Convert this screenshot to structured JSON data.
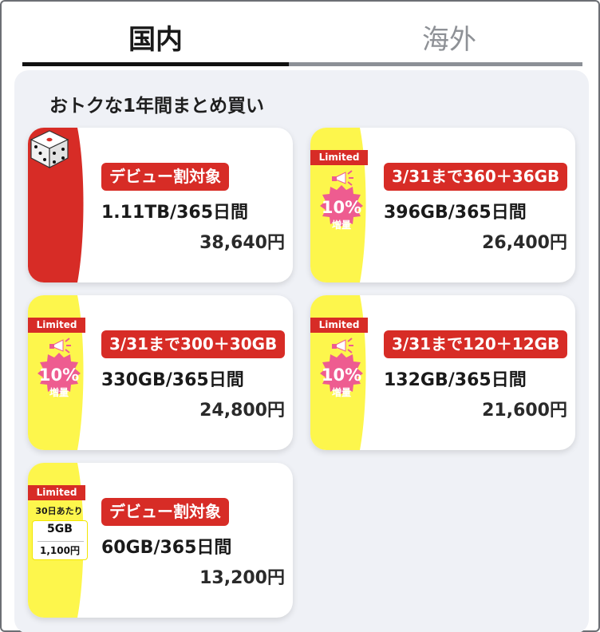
{
  "tabs": [
    {
      "label": "国内",
      "active": true
    },
    {
      "label": "海外",
      "active": false
    }
  ],
  "section_title": "おトクな1年間まとめ買い",
  "colors": {
    "red": "#d72c26",
    "yellow": "#fdf64c",
    "pink": "#ee5c90",
    "panel_bg": "#eff1f6"
  },
  "cards": [
    {
      "type": "dice",
      "icon": "dice-icon",
      "badge": "デビュー割対象",
      "plan": "1.11TB/365日間",
      "price": "38,640円"
    },
    {
      "type": "limited10",
      "limited": "Limited",
      "pct": "10%",
      "increase": "増量",
      "badge": "3/31まで360＋36GB",
      "plan": "396GB/365日間",
      "price": "26,400円"
    },
    {
      "type": "limited10",
      "limited": "Limited",
      "pct": "10%",
      "increase": "増量",
      "badge": "3/31まで300＋30GB",
      "plan": "330GB/365日間",
      "price": "24,800円"
    },
    {
      "type": "limited10",
      "limited": "Limited",
      "pct": "10%",
      "increase": "増量",
      "badge": "3/31まで120＋12GB",
      "plan": "132GB/365日間",
      "price": "21,600円"
    },
    {
      "type": "limited-daily",
      "limited": "Limited",
      "per_day": "30日あたり",
      "daily_gb": "5GB",
      "daily_price": "1,100円",
      "badge": "デビュー割対象",
      "plan": "60GB/365日間",
      "price": "13,200円"
    }
  ]
}
